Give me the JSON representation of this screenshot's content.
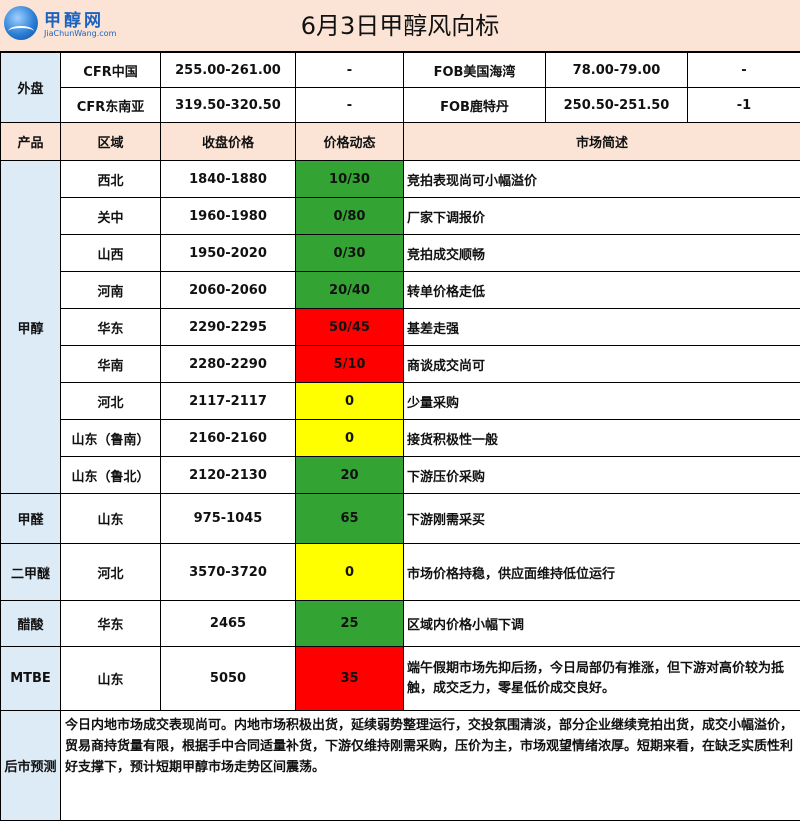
{
  "header": {
    "logo_name": "甲醇网",
    "logo_url": "JiaChunWang.com",
    "title": "6月3日甲醇风向标"
  },
  "foreign": {
    "label": "外盘",
    "rows": [
      {
        "left_name": "CFR中国",
        "left_price": "255.00-261.00",
        "left_change": "-",
        "right_name": "FOB美国海湾",
        "right_price": "78.00-79.00",
        "right_change": "-"
      },
      {
        "left_name": "CFR东南亚",
        "left_price": "319.50-320.50",
        "left_change": "-",
        "right_name": "FOB鹿特丹",
        "right_price": "250.50-251.50",
        "right_change": "-1"
      }
    ]
  },
  "columns": {
    "product": "产品",
    "region": "区域",
    "price": "收盘价格",
    "change": "价格动态",
    "comment": "市场简述"
  },
  "methanol": {
    "label": "甲醇",
    "rows": [
      {
        "region": "西北",
        "price": "1840-1880",
        "change": "10/30",
        "comment": "竞拍表现尚可小幅溢价"
      },
      {
        "region": "关中",
        "price": "1960-1980",
        "change": "0/80",
        "comment": "厂家下调报价"
      },
      {
        "region": "山西",
        "price": "1950-2020",
        "change": "0/30",
        "comment": "竞拍成交顺畅"
      },
      {
        "region": "河南",
        "price": "2060-2060",
        "change": "20/40",
        "comment": "转单价格走低"
      },
      {
        "region": "华东",
        "price": "2290-2295",
        "change": "50/45",
        "comment": "基差走强"
      },
      {
        "region": "华南",
        "price": "2280-2290",
        "change": "5/10",
        "comment": "商谈成交尚可"
      },
      {
        "region": "河北",
        "price": "2117-2117",
        "change": "0",
        "comment": "少量采购"
      },
      {
        "region": "山东（鲁南）",
        "price": "2160-2160",
        "change": "0",
        "comment": "接货积极性一般"
      },
      {
        "region": "山东（鲁北）",
        "price": "2120-2130",
        "change": "20",
        "comment": "下游压价采购"
      }
    ]
  },
  "formaldehyde": {
    "label": "甲醛",
    "region": "山东",
    "price": "975-1045",
    "change": "65",
    "comment": "下游刚需采买"
  },
  "dme": {
    "label": "二甲醚",
    "region": "河北",
    "price": "3570-3720",
    "change": "0",
    "comment": "市场价格持稳，供应面维持低位运行"
  },
  "acetic": {
    "label": "醋酸",
    "region": "华东",
    "price": "2465",
    "change": "25",
    "comment": "区域内价格小幅下调"
  },
  "mtbe": {
    "label": "MTBE",
    "region": "山东",
    "price": "5050",
    "change": "35",
    "comment": "端午假期市场先抑后扬，今日局部仍有推涨，但下游对高价较为抵触，成交乏力，零星低价成交良好。"
  },
  "forecast": {
    "label": "后市预测",
    "text": "今日内地市场成交表现尚可。内地市场积极出货，延续弱势整理运行，交投氛围清淡，部分企业继续竞拍出货，成交小幅溢价，贸易商持货量有限，根据手中合同适量补货，下游仅维持刚需采购，压价为主，市场观望情绪浓厚。短期来看，在缺乏实质性利好支撑下，预计短期甲醇市场走势区间震荡。"
  },
  "colors": {
    "up_green": "#33a333",
    "down_red": "#ff0000",
    "flat_yellow": "#ffff00",
    "header_bg": "#fbe4d5",
    "category_bg": "#ddebf7"
  }
}
